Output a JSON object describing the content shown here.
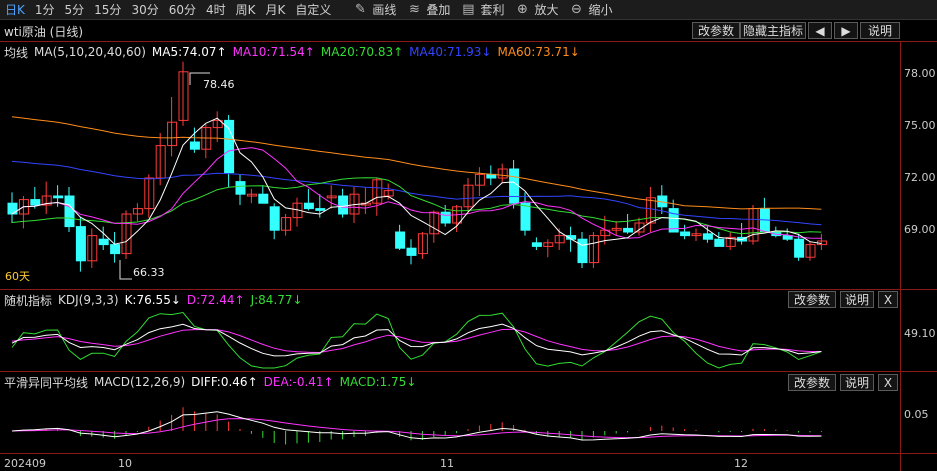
{
  "toolbar": {
    "periods": [
      "日K",
      "1分",
      "5分",
      "15分",
      "30分",
      "60分",
      "4时",
      "周K",
      "月K",
      "自定义"
    ],
    "active_period": "日K",
    "tools": [
      {
        "label": "画线",
        "icon": "pencil-icon"
      },
      {
        "label": "叠加",
        "icon": "stack-icon"
      },
      {
        "label": "套利",
        "icon": "arbitrage-icon"
      },
      {
        "label": "放大",
        "icon": "zoom-in-icon"
      },
      {
        "label": "缩小",
        "icon": "zoom-out-icon"
      }
    ]
  },
  "main_panel": {
    "title": "wti原油 (日线)",
    "indicator_name": "均线",
    "indicator_params": "MA(5,10,20,40,60)",
    "ma_values": [
      {
        "label": "MA5:74.07↑",
        "color": "#ffffff"
      },
      {
        "label": "MA10:71.54↑",
        "color": "#ff33ff"
      },
      {
        "label": "MA20:70.83↑",
        "color": "#33dd33"
      },
      {
        "label": "MA40:71.93↓",
        "color": "#3344ff"
      },
      {
        "label": "MA60:73.71↓",
        "color": "#ff8c1a"
      }
    ],
    "buttons": {
      "modify": "改参数",
      "hide": "隐藏主指标",
      "prev": "🡐",
      "next": "🡒",
      "help": "说明"
    },
    "y_ticks": [
      "78.00",
      "75.00",
      "72.00",
      "69.00"
    ],
    "high_label": "78.46",
    "low_label": "66.33",
    "ma60_tag": "60天"
  },
  "kdj_panel": {
    "title": "随机指标",
    "params": "KDJ(9,3,3)",
    "k": "K:76.55↓",
    "d": "D:72.44↑",
    "j": "J:84.77↓",
    "y_tick": "49.10",
    "buttons": {
      "modify": "改参数",
      "help": "说明",
      "close": "X"
    }
  },
  "macd_panel": {
    "title": "平滑异同平均线",
    "params": "MACD(12,26,9)",
    "diff": "DIFF:0.46↑",
    "dea": "DEA:-0.41↑",
    "macd": "MACD:1.75↓",
    "y_tick": "0.05",
    "buttons": {
      "modify": "改参数",
      "help": "说明",
      "close": "X"
    }
  },
  "x_axis": [
    "202409",
    "10",
    "11",
    "12"
  ],
  "colors": {
    "up": "#ff3b3b",
    "down": "#33ffff",
    "grid": "#8a1a1a"
  },
  "chart_data": {
    "type": "candlestick",
    "y_range": [
      66.0,
      79.0
    ],
    "candles": [
      [
        70.6,
        71.2,
        69.5,
        70.0
      ],
      [
        70.0,
        71.0,
        69.2,
        70.8
      ],
      [
        70.8,
        71.5,
        70.3,
        70.5
      ],
      [
        70.5,
        71.8,
        70.0,
        71.0
      ],
      [
        71.0,
        71.6,
        70.4,
        70.9
      ],
      [
        71.0,
        71.5,
        69.0,
        69.3
      ],
      [
        69.3,
        69.8,
        66.8,
        67.4
      ],
      [
        67.4,
        69.2,
        67.0,
        68.8
      ],
      [
        68.6,
        69.3,
        68.0,
        68.3
      ],
      [
        68.3,
        69.0,
        67.3,
        67.8
      ],
      [
        67.8,
        70.2,
        67.5,
        70.0
      ],
      [
        70.0,
        70.6,
        69.6,
        70.3
      ],
      [
        70.3,
        72.2,
        69.8,
        72.0
      ],
      [
        72.0,
        74.5,
        71.6,
        73.8
      ],
      [
        73.8,
        76.5,
        73.2,
        75.1
      ],
      [
        75.2,
        78.46,
        74.9,
        77.9
      ],
      [
        74.0,
        74.8,
        73.4,
        73.6
      ],
      [
        73.6,
        75.0,
        73.1,
        74.8
      ],
      [
        74.8,
        75.7,
        74.0,
        75.2
      ],
      [
        75.2,
        75.5,
        71.5,
        72.3
      ],
      [
        71.8,
        72.2,
        70.5,
        71.1
      ],
      [
        71.0,
        71.4,
        70.6,
        71.1
      ],
      [
        71.1,
        71.6,
        70.6,
        70.6
      ],
      [
        70.4,
        70.6,
        68.6,
        69.1
      ],
      [
        69.1,
        70.0,
        68.8,
        69.8
      ],
      [
        69.8,
        70.9,
        69.3,
        70.6
      ],
      [
        70.6,
        71.4,
        70.2,
        70.3
      ],
      [
        70.3,
        71.1,
        69.8,
        70.2
      ],
      [
        70.9,
        71.6,
        70.3,
        71.0
      ],
      [
        71.0,
        71.4,
        69.8,
        70.0
      ],
      [
        70.0,
        71.5,
        69.5,
        71.1
      ],
      [
        70.5,
        71.5,
        70.0,
        70.6
      ],
      [
        70.6,
        72.0,
        69.9,
        71.9
      ],
      [
        71.0,
        71.7,
        70.8,
        71.3
      ],
      [
        69.0,
        69.4,
        68.0,
        68.1
      ],
      [
        68.1,
        68.6,
        67.2,
        67.7
      ],
      [
        67.8,
        69.0,
        67.5,
        68.9
      ],
      [
        68.9,
        70.2,
        68.4,
        70.1
      ],
      [
        70.1,
        70.5,
        69.3,
        69.5
      ],
      [
        69.5,
        70.5,
        69.0,
        70.4
      ],
      [
        70.4,
        72.0,
        70.0,
        71.6
      ],
      [
        71.6,
        72.6,
        71.0,
        72.2
      ],
      [
        72.2,
        72.7,
        71.6,
        72.0
      ],
      [
        72.0,
        72.8,
        71.7,
        72.5
      ],
      [
        72.5,
        73.0,
        70.3,
        70.6
      ],
      [
        70.6,
        71.2,
        68.8,
        69.1
      ],
      [
        68.4,
        68.7,
        68.0,
        68.2
      ],
      [
        68.2,
        68.6,
        67.6,
        68.4
      ],
      [
        68.4,
        69.2,
        68.0,
        68.8
      ],
      [
        68.8,
        69.3,
        67.9,
        68.6
      ],
      [
        68.6,
        69.0,
        67.0,
        67.3
      ],
      [
        67.3,
        69.0,
        67.0,
        68.8
      ],
      [
        68.8,
        69.9,
        68.3,
        69.1
      ],
      [
        69.1,
        69.6,
        68.8,
        69.2
      ],
      [
        69.2,
        70.0,
        68.9,
        69.0
      ],
      [
        69.0,
        69.8,
        68.8,
        69.5
      ],
      [
        69.5,
        71.5,
        69.0,
        70.9
      ],
      [
        71.0,
        71.6,
        70.0,
        70.4
      ],
      [
        70.3,
        70.8,
        69.4,
        69.0
      ],
      [
        69.0,
        69.4,
        68.6,
        68.8
      ],
      [
        68.8,
        69.2,
        68.5,
        68.9
      ],
      [
        68.9,
        69.3,
        68.4,
        68.6
      ],
      [
        68.6,
        69.0,
        68.2,
        68.2
      ],
      [
        68.2,
        69.0,
        68.0,
        68.7
      ],
      [
        68.7,
        69.5,
        68.3,
        68.5
      ],
      [
        68.5,
        70.5,
        68.3,
        70.3
      ],
      [
        70.3,
        70.9,
        69.9,
        69.0
      ],
      [
        69.0,
        69.3,
        68.7,
        68.8
      ],
      [
        68.8,
        69.2,
        68.5,
        68.6
      ],
      [
        68.6,
        68.9,
        67.4,
        67.6
      ],
      [
        67.6,
        68.5,
        67.4,
        68.3
      ],
      [
        68.3,
        68.9,
        68.0,
        68.5
      ]
    ]
  }
}
